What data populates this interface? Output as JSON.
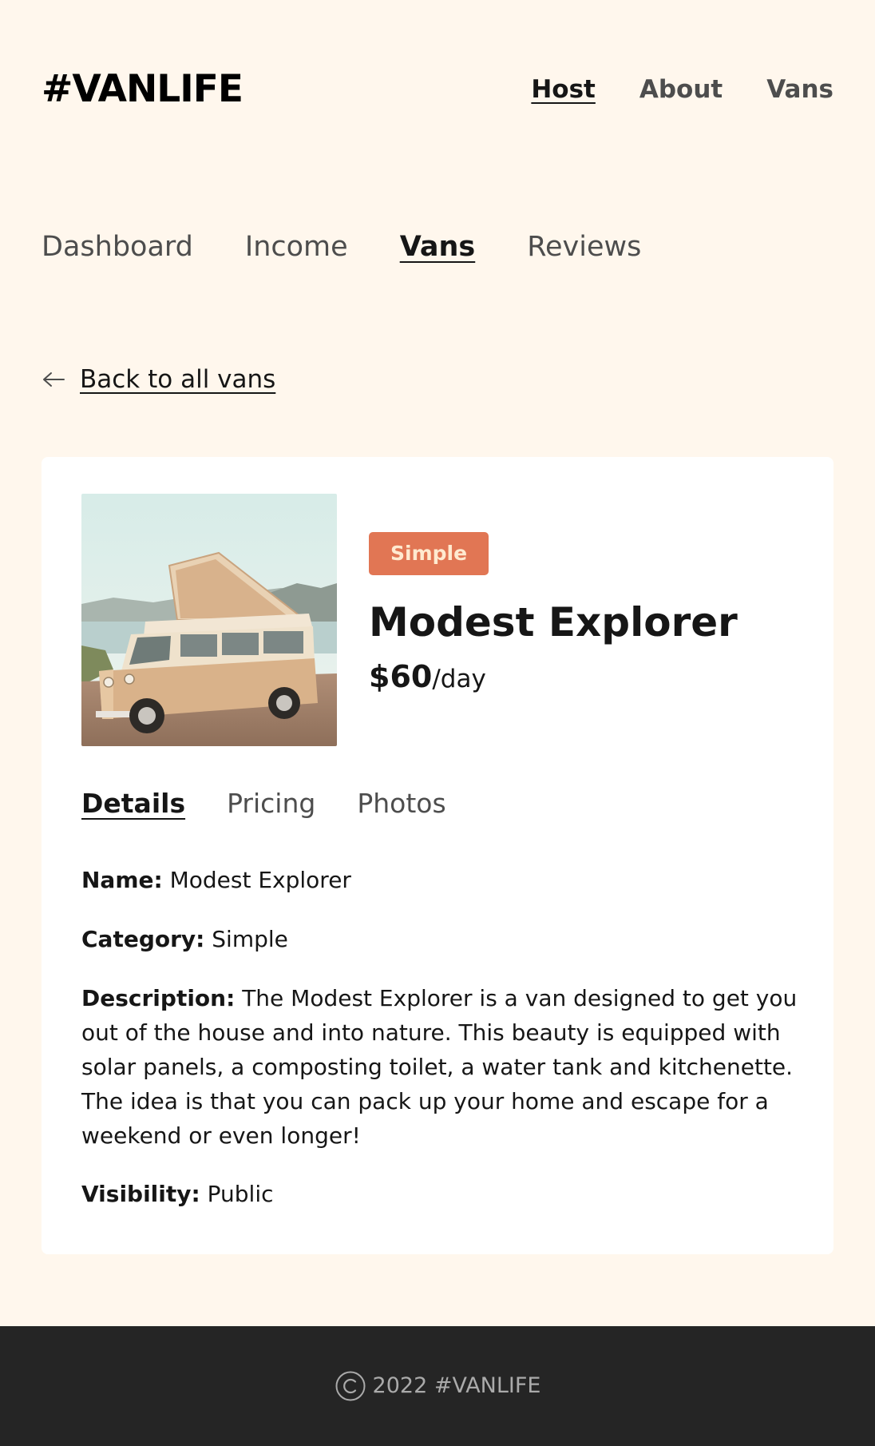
{
  "header": {
    "logo": "#VANLIFE",
    "nav": {
      "host": "Host",
      "about": "About",
      "vans": "Vans"
    }
  },
  "host_nav": {
    "dashboard": "Dashboard",
    "income": "Income",
    "vans": "Vans",
    "reviews": "Reviews"
  },
  "back_link": {
    "label": "Back to all vans",
    "icon": "arrow-left-icon"
  },
  "van": {
    "image_alt": "Modest Explorer van photo",
    "category_badge": "Simple",
    "name": "Modest Explorer",
    "price": "$60",
    "price_unit": "/day",
    "badge_color": "#E17654"
  },
  "tabs": {
    "details": "Details",
    "pricing": "Pricing",
    "photos": "Photos"
  },
  "details": {
    "name_label": "Name:",
    "name_value": "Modest Explorer",
    "category_label": "Category:",
    "category_value": "Simple",
    "description_label": "Description:",
    "description_value": "The Modest Explorer is a van designed to get you out of the house and into nature. This beauty is equipped with solar panels, a composting toilet, a water tank and kitchenette. The idea is that you can pack up your home and escape for a weekend or even longer!",
    "visibility_label": "Visibility:",
    "visibility_value": "Public"
  },
  "footer": {
    "icon": "copyright-icon",
    "text": "2022 #VANLIFE"
  },
  "colors": {
    "background": "#FFF7ED",
    "card": "#FFFFFF",
    "footer": "#252525",
    "accent": "#E17654"
  }
}
